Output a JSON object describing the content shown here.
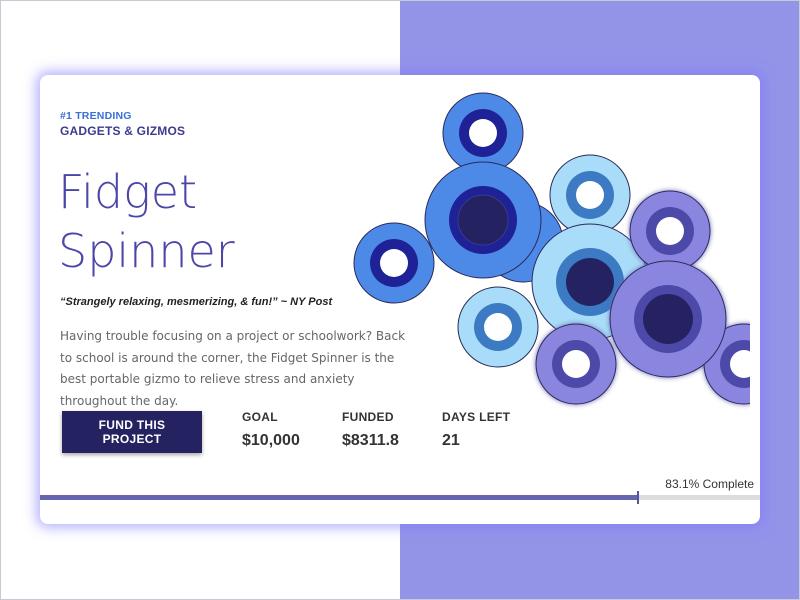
{
  "card": {
    "eyebrow": "#1 TRENDING",
    "category": "GADGETS & GIZMOS",
    "title_lines": [
      "Fidget",
      "Spinner"
    ],
    "quote": "“Strangely relaxing, mesmerizing, & fun!” ~ NY Post",
    "description": "Having trouble focusing on a project or schoolwork? Back to school is around the corner, the Fidget Spinner is the best portable gizmo to relieve stress and anxiety throughout the day.",
    "cta_label": "FUND THIS PROJECT"
  },
  "stats": [
    {
      "label": "GOAL",
      "value": "$10,000"
    },
    {
      "label": "FUNDED",
      "value": "$8311.8"
    },
    {
      "label": "DAYS LEFT",
      "value": "21"
    }
  ],
  "progress": {
    "percent": 83.1,
    "label": "83.1% Complete"
  },
  "colors": {
    "background_accent": "#9394e8",
    "button": "#252262",
    "title": "#4b46a8",
    "spinner_blue": "#4d8ae8",
    "spinner_light": "#a8dcf8",
    "spinner_purple": "#8a86e0"
  }
}
